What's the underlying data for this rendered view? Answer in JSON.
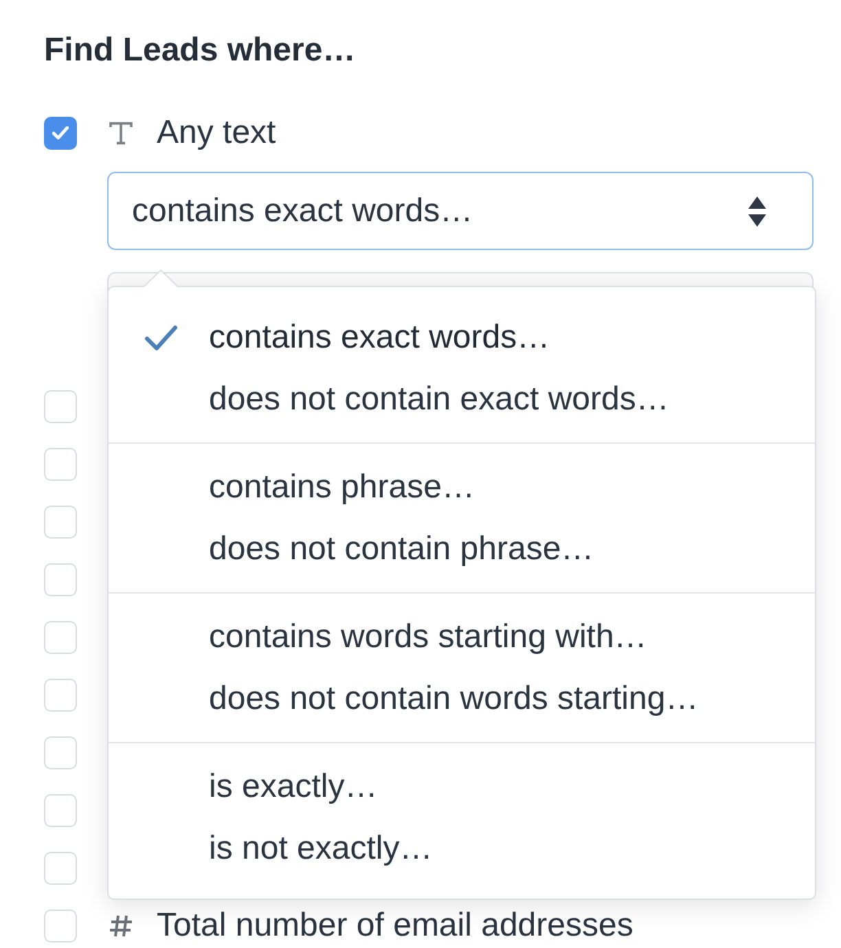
{
  "heading": "Find Leads where…",
  "criteria": [
    {
      "kind": "text",
      "checked": true,
      "label": "Any text",
      "operator": "contains exact words…"
    },
    {
      "checked": false
    },
    {
      "checked": false
    },
    {
      "checked": false
    },
    {
      "checked": false
    },
    {
      "checked": false
    },
    {
      "checked": false
    },
    {
      "checked": false
    },
    {
      "checked": false
    },
    {
      "checked": false
    },
    {
      "kind": "number",
      "checked": false,
      "label": "Total number of email addresses"
    }
  ],
  "operator_menu": {
    "groups": [
      {
        "options": [
          {
            "label": "contains exact words…",
            "selected": true
          },
          {
            "label": "does not contain exact words…",
            "selected": false
          }
        ]
      },
      {
        "options": [
          {
            "label": "contains phrase…",
            "selected": false
          },
          {
            "label": "does not contain phrase…",
            "selected": false
          }
        ]
      },
      {
        "options": [
          {
            "label": "contains words starting with…",
            "selected": false
          },
          {
            "label": "does not contain words starting…",
            "selected": false
          }
        ]
      },
      {
        "options": [
          {
            "label": "is exactly…",
            "selected": false
          },
          {
            "label": "is not exactly…",
            "selected": false
          }
        ]
      }
    ]
  }
}
